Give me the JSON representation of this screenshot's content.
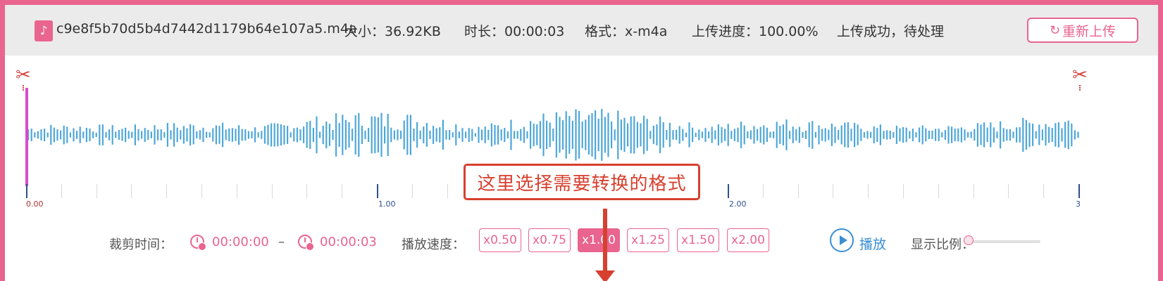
{
  "file_info": {
    "icon": "music-file-icon",
    "filename": "c9e8f5b70d5b4d7442d1179b64e107a5.m4a",
    "size": "大小：36.92KB",
    "duration": "时长：00:00:03",
    "format": "格式：x-m4a",
    "progress": "上传进度：100.00%",
    "status": "上传成功，待处理",
    "reupload_label": "重新上传"
  },
  "waveform": {
    "color": "#4ea7d9",
    "playhead_color": "#d94ccb",
    "ruler_labels": [
      "0.00",
      "1.00",
      "2.00",
      "3"
    ]
  },
  "annotation": {
    "text": "这里选择需要转换的格式",
    "color": "#d7402f"
  },
  "controls": {
    "trim_label": "裁剪时间：",
    "trim_start": "00:00:00",
    "trim_sep": "–",
    "trim_end": "00:00:03",
    "speed_label": "播放速度：",
    "speeds": [
      "x0.50",
      "x0.75",
      "x1.00",
      "x1.25",
      "x1.50",
      "x2.00"
    ],
    "active_speed": "x1.00",
    "play_label": "播放",
    "zoom_label": "显示比例：",
    "zoom_value": 0
  },
  "colors": {
    "accent": "#e9648f",
    "blue": "#3a8fd4"
  }
}
